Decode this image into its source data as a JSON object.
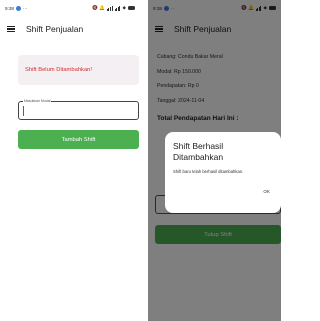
{
  "left_screen": {
    "status_bar": {
      "time": "9:38",
      "indicator": "···",
      "icons": "🔇 🔔"
    },
    "app_bar": {
      "title": "Shift Penjualan"
    },
    "warning": {
      "text": "Shift Belum Ditambahkan!"
    },
    "modal_field": {
      "label": "Masukkan Modal"
    },
    "add_button": {
      "label": "Tambah Shift"
    }
  },
  "right_screen": {
    "status_bar": {
      "time": "9:38",
      "indicator": "··",
      "icons": "🔇 🔔"
    },
    "app_bar": {
      "title": "Shift Penjualan"
    },
    "info": {
      "cabang": "Cabang: Condu Bakar Meral",
      "modal": "Modal: Rp 150.000",
      "pendapatan": "Pendapatan: Rp 0",
      "tanggal": "Tanggal: 2024-11-04"
    },
    "summary_title": "Total Pendapatan Hari Ini :",
    "close_button": {
      "label": "Tutup Shift"
    },
    "dialog": {
      "title": "Shift Berhasil Ditambahkan",
      "message": "Shift baru telah berhasil ditambahkan.",
      "ok_label": "OK"
    }
  },
  "colors": {
    "primary_green": "#4caf50",
    "warning_red": "#d32f2f",
    "card_background": "#f3eff2",
    "scrim": "rgba(0,0,0,0.5)"
  }
}
